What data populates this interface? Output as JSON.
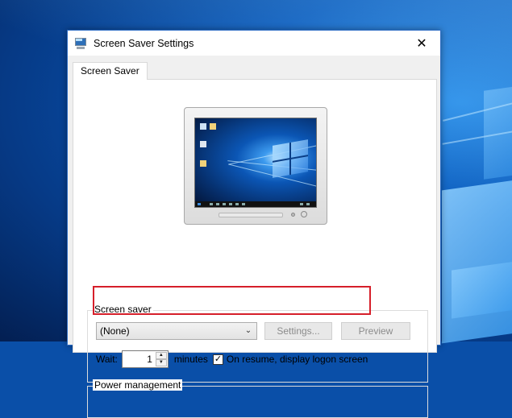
{
  "window": {
    "title": "Screen Saver Settings",
    "close_glyph": "✕",
    "icon": "screen-saver-app-icon"
  },
  "tabs": [
    {
      "label": "Screen Saver",
      "active": true
    }
  ],
  "screen_saver": {
    "group_label": "Screen saver",
    "selected": "(None)",
    "settings_label": "Settings...",
    "preview_label": "Preview",
    "wait_label": "Wait:",
    "wait_value": "1",
    "minutes_label": "minutes",
    "logon_checked": true,
    "logon_label": "On resume, display logon screen",
    "highlight_color": "#d61f2a"
  },
  "power": {
    "group_label": "Power management"
  },
  "colors": {
    "accent_border": "#2c6cc4",
    "highlight": "#d61f2a"
  }
}
